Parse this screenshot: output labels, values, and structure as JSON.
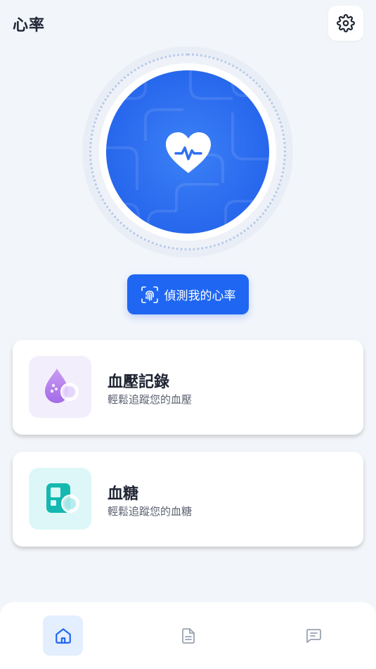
{
  "header": {
    "title": "心率",
    "settings_icon": "gear-icon"
  },
  "hero": {
    "icon": "heart-pulse-icon",
    "accent_color": "#1F66F2"
  },
  "detect_button": {
    "icon": "fingerprint-scan-icon",
    "label": "偵測我的心率"
  },
  "cards": [
    {
      "title": "血壓記錄",
      "subtitle": "輕鬆追蹤您的血壓",
      "icon": "blood-drop-icon",
      "icon_bg": "#F3EEFC"
    },
    {
      "title": "血糖",
      "subtitle": "輕鬆追蹤您的血糖",
      "icon": "glucose-meter-icon",
      "icon_bg": "#DDF7F8"
    }
  ],
  "bottom_nav": {
    "items": [
      {
        "icon": "home-icon",
        "active": true
      },
      {
        "icon": "document-icon",
        "active": false
      },
      {
        "icon": "message-icon",
        "active": false
      }
    ]
  }
}
